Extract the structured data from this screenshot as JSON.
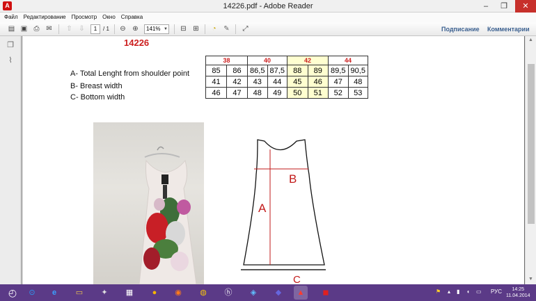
{
  "window": {
    "title": "14226.pdf - Adobe Reader",
    "app_icon": "adobe-reader-icon",
    "minimize": "–",
    "maximize": "❐",
    "close": "✕"
  },
  "menu": [
    "Файл",
    "Редактирование",
    "Просмотр",
    "Окно",
    "Справка"
  ],
  "toolbar": {
    "page_current": "1",
    "page_total": "/ 1",
    "zoom": "141%",
    "sign_label": "Подписание",
    "comments_label": "Комментарии"
  },
  "document": {
    "title": "14226",
    "table": {
      "sizes": [
        "38",
        "40",
        "42",
        "44"
      ],
      "highlight_size": "42",
      "rows": [
        {
          "label": "A- Total Lenght from shoulder point",
          "values": [
            "85",
            "86",
            "86,5",
            "87,5",
            "88",
            "89",
            "89,5",
            "90,5"
          ]
        },
        {
          "label": "B- Breast width",
          "values": [
            "41",
            "42",
            "43",
            "44",
            "45",
            "46",
            "47",
            "48"
          ]
        },
        {
          "label": "C- Bottom width",
          "values": [
            "46",
            "47",
            "48",
            "49",
            "50",
            "51",
            "52",
            "53"
          ]
        }
      ]
    },
    "sketch_labels": {
      "a": "A",
      "b": "B",
      "c": "C"
    },
    "colors": {
      "accent_red": "#cc1f1f",
      "highlight": "#ffffd0"
    }
  },
  "taskbar": {
    "tray_lang": "РУС",
    "time": "14:25",
    "date": "11.04.2014"
  }
}
